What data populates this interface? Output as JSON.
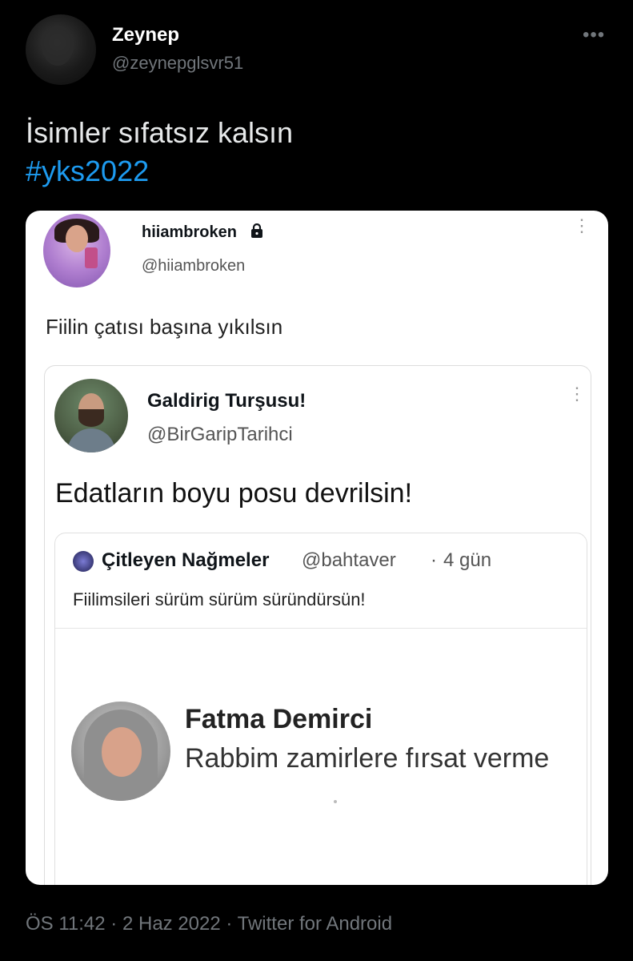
{
  "tweet": {
    "author": {
      "name": "Zeynep",
      "handle": "@zeynepglsvr51",
      "avatar_icon": "avatar"
    },
    "more_label": "•••",
    "text": "İsimler sıfatsız kalsın",
    "hashtag": "#yks2022",
    "meta": {
      "time": "ÖS 11:42",
      "separator": "·",
      "date": "2 Haz 2022",
      "source": "Twitter for Android"
    },
    "accent_color": "#1d9bf0"
  },
  "image": {
    "post": {
      "name": "hiiambroken",
      "handle": "@hiiambroken",
      "lock_icon": "lock-icon",
      "kebab": "⋮",
      "text": "Fiilin çatısı başına yıkılsın"
    },
    "quote": {
      "name": "Galdirig Turşusu!",
      "handle": "@BirGaripTarihci",
      "kebab": "⋮",
      "text": "Edatların boyu posu devrilsin!"
    },
    "nested_quote": {
      "name": "Çitleyen Nağmeler",
      "handle": "@bahtaver",
      "dot": "·",
      "time": "4 gün",
      "text": "Fiilimsileri sürüm sürüm süründürsün!"
    },
    "embedded": {
      "name": "Fatma Demirci",
      "text": "Rabbim zamirlere fırsat verme"
    }
  }
}
